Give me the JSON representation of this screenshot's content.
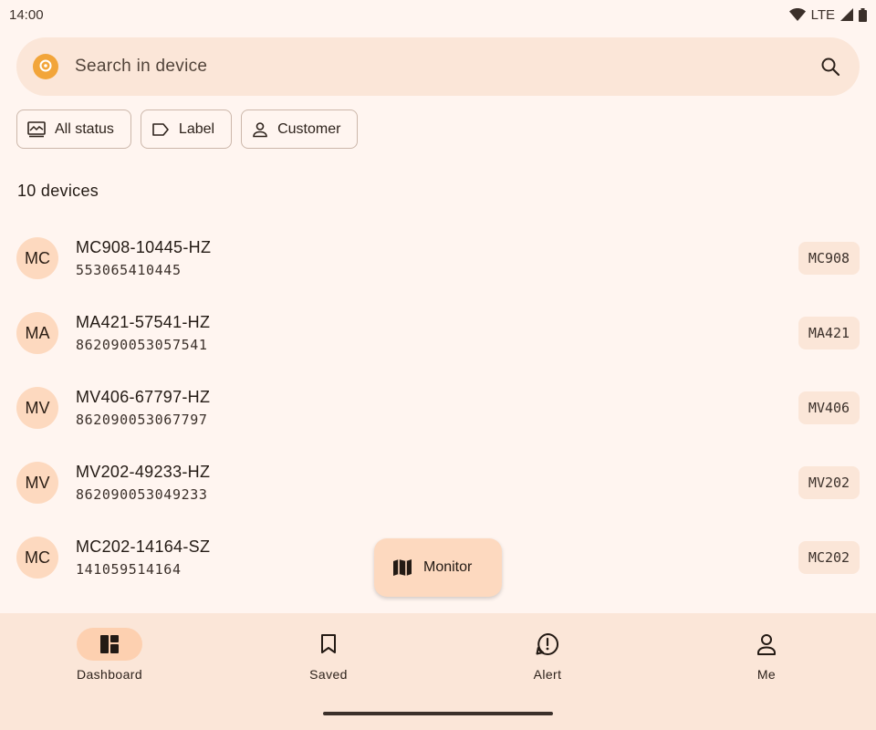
{
  "status_bar": {
    "time": "14:00",
    "network": "LTE"
  },
  "search": {
    "placeholder": "Search in device"
  },
  "filters": [
    {
      "label": "All status",
      "icon": "monitor-chart-icon"
    },
    {
      "label": "Label",
      "icon": "label-tag-icon"
    },
    {
      "label": "Customer",
      "icon": "person-icon"
    }
  ],
  "device_count": "10 devices",
  "devices": [
    {
      "initials": "MC",
      "name": "MC908-10445-HZ",
      "serial": "553065410445",
      "model": "MC908"
    },
    {
      "initials": "MA",
      "name": "MA421-57541-HZ",
      "serial": "862090053057541",
      "model": "MA421"
    },
    {
      "initials": "MV",
      "name": "MV406-67797-HZ",
      "serial": "862090053067797",
      "model": "MV406"
    },
    {
      "initials": "MV",
      "name": "MV202-49233-HZ",
      "serial": "862090053049233",
      "model": "MV202"
    },
    {
      "initials": "MC",
      "name": "MC202-14164-SZ",
      "serial": "141059514164",
      "model": "MC202"
    }
  ],
  "fab": {
    "label": "Monitor",
    "icon": "map-icon"
  },
  "nav": [
    {
      "label": "Dashboard",
      "icon": "dashboard-icon",
      "active": true
    },
    {
      "label": "Saved",
      "icon": "bookmark-icon",
      "active": false
    },
    {
      "label": "Alert",
      "icon": "alert-icon",
      "active": false
    },
    {
      "label": "Me",
      "icon": "person-icon",
      "active": false
    }
  ],
  "colors": {
    "background": "#fff5f0",
    "surface": "#fbe6d8",
    "accent": "#fdd9bf",
    "logo": "#f2a53a"
  }
}
